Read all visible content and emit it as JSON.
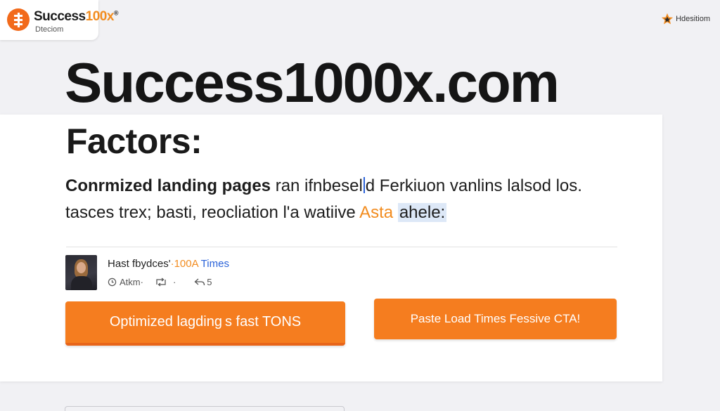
{
  "header": {
    "logo": {
      "name_main": "Success",
      "name_accent": "100x",
      "name_sup": "®",
      "sub": "Dteciom"
    },
    "partner": {
      "icon": "star-icon",
      "label": "Hdesitiom"
    }
  },
  "hero": {
    "title": "Success1000x.com"
  },
  "card": {
    "title": "Factors:",
    "line1_bold": "Conrmized landing pages",
    "line1_a": " ran ifnbesel",
    "line1_b": "d",
    "line1_c": " Ferkiuon vanlins lalsod los.",
    "line2_a": "tasces trex; basti, reocliation l'a watiive ",
    "line2_orange": "Asta",
    "line2_space": " ",
    "line2_selected": "ahele:",
    "post": {
      "title_a": "Hast fbydces'",
      "title_orange": "·100A",
      "title_blue": " Times",
      "meta_time": "Atkm·",
      "meta_retweet_suffix": "·",
      "meta_likes": "5"
    },
    "primary_button": "Optimized lagding s fast TONS",
    "secondary_button": "Paste Load Times Fessive CTA!"
  },
  "colors": {
    "accent": "#f57d1f",
    "link_blue": "#2b63d9",
    "background": "#f1f1f4"
  }
}
